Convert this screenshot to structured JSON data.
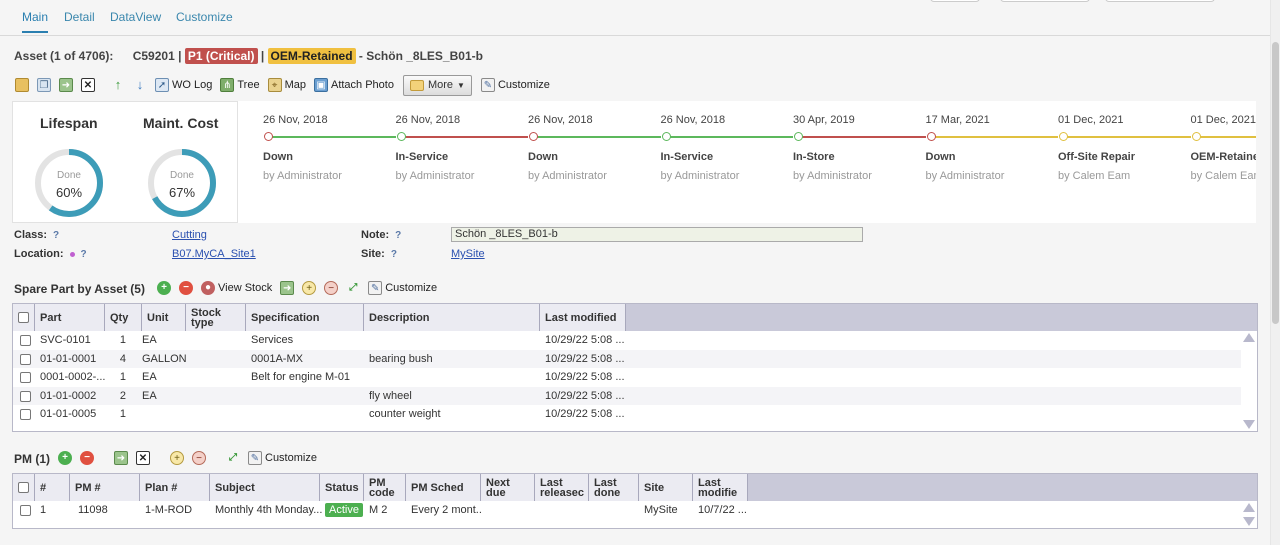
{
  "tabs": [
    {
      "label": "Main"
    },
    {
      "label": "Detail"
    },
    {
      "label": "DataView"
    },
    {
      "label": "Customize"
    }
  ],
  "asset": {
    "label": "Asset (1 of 4706):",
    "id": "C59201",
    "sep": "|",
    "priority": "P1 (Critical)",
    "owner": "OEM-Retained",
    "name": "- Schön _8LES_B01-b"
  },
  "toolbar": {
    "wo_log": "WO Log",
    "tree": "Tree",
    "map": "Map",
    "attach_photo": "Attach Photo",
    "more": "More",
    "customize": "Customize"
  },
  "gauges": [
    {
      "label": "Lifespan",
      "done": "Done",
      "pct": "60%",
      "value": 0.6
    },
    {
      "label": "Maint. Cost",
      "done": "Done",
      "pct": "67%",
      "value": 0.67
    }
  ],
  "timeline": [
    {
      "date": "26 Nov, 2018",
      "status": "Down",
      "by": "by Administrator",
      "color": "#c0504d"
    },
    {
      "date": "26 Nov, 2018",
      "status": "In-Service",
      "by": "by Administrator",
      "color": "#5cb85c"
    },
    {
      "date": "26 Nov, 2018",
      "status": "Down",
      "by": "by Administrator",
      "color": "#c0504d"
    },
    {
      "date": "26 Nov, 2018",
      "status": "In-Service",
      "by": "by Administrator",
      "color": "#5cb85c"
    },
    {
      "date": "30 Apr, 2019",
      "status": "In-Store",
      "by": "by Administrator",
      "color": "#5cb85c"
    },
    {
      "date": "17 Mar, 2021",
      "status": "Down",
      "by": "by Administrator",
      "color": "#c0504d"
    },
    {
      "date": "01 Dec, 2021",
      "status": "Off-Site Repair",
      "by": "by Calem Eam",
      "color": "#e0c040"
    },
    {
      "date": "01 Dec, 2021",
      "status": "OEM-Retained",
      "by": "by Calem Eam",
      "color": "#e0c040"
    }
  ],
  "fields": {
    "class_label": "Class:",
    "class_value": "Cutting",
    "location_label": "Location:",
    "location_value": "B07.MyCA_Site1",
    "note_label": "Note:",
    "note_value": "Schön _8LES_B01-b",
    "site_label": "Site:",
    "site_value": "MySite",
    "help": "?"
  },
  "spare": {
    "title": "Spare Part by Asset (5)",
    "view_stock": "View Stock",
    "customize": "Customize",
    "columns": [
      "Part",
      "Qty",
      "Unit",
      "Stock type",
      "Specification",
      "Description",
      "Last modified"
    ],
    "rows": [
      {
        "part": "SVC-0101",
        "qty": "1",
        "unit": "EA",
        "stock_type": "",
        "spec": "Services",
        "desc": "",
        "modified": "10/29/22 5:08 ..."
      },
      {
        "part": "01-01-0001",
        "qty": "4",
        "unit": "GALLON",
        "stock_type": "",
        "spec": "0001A-MX",
        "desc": "bearing bush",
        "modified": "10/29/22 5:08 ..."
      },
      {
        "part": "0001-0002-...",
        "qty": "1",
        "unit": "EA",
        "stock_type": "",
        "spec": "Belt for engine M-01",
        "desc": "",
        "modified": "10/29/22 5:08 ..."
      },
      {
        "part": "01-01-0002",
        "qty": "2",
        "unit": "EA",
        "stock_type": "",
        "spec": "",
        "desc": "fly wheel",
        "modified": "10/29/22 5:08 ..."
      },
      {
        "part": "01-01-0005",
        "qty": "1",
        "unit": "",
        "stock_type": "",
        "spec": "",
        "desc": "counter weight",
        "modified": "10/29/22 5:08 ..."
      }
    ]
  },
  "pm": {
    "title": "PM (1)",
    "customize": "Customize",
    "columns": [
      "#",
      "PM #",
      "Plan #",
      "Subject",
      "Status",
      "PM code",
      "PM Sched",
      "Next due",
      "Last releasec",
      "Last done",
      "Site",
      "Last modifie"
    ],
    "rows": [
      {
        "num": "1",
        "pm_no": "11098",
        "plan": "1-M-ROD",
        "subject": "Monthly 4th Monday...",
        "status": "Active",
        "code": "M 2",
        "sched": "Every 2 mont...",
        "next_due": "",
        "last_released": "",
        "last_done": "",
        "site": "MySite",
        "modified": "10/7/22 ..."
      }
    ]
  }
}
